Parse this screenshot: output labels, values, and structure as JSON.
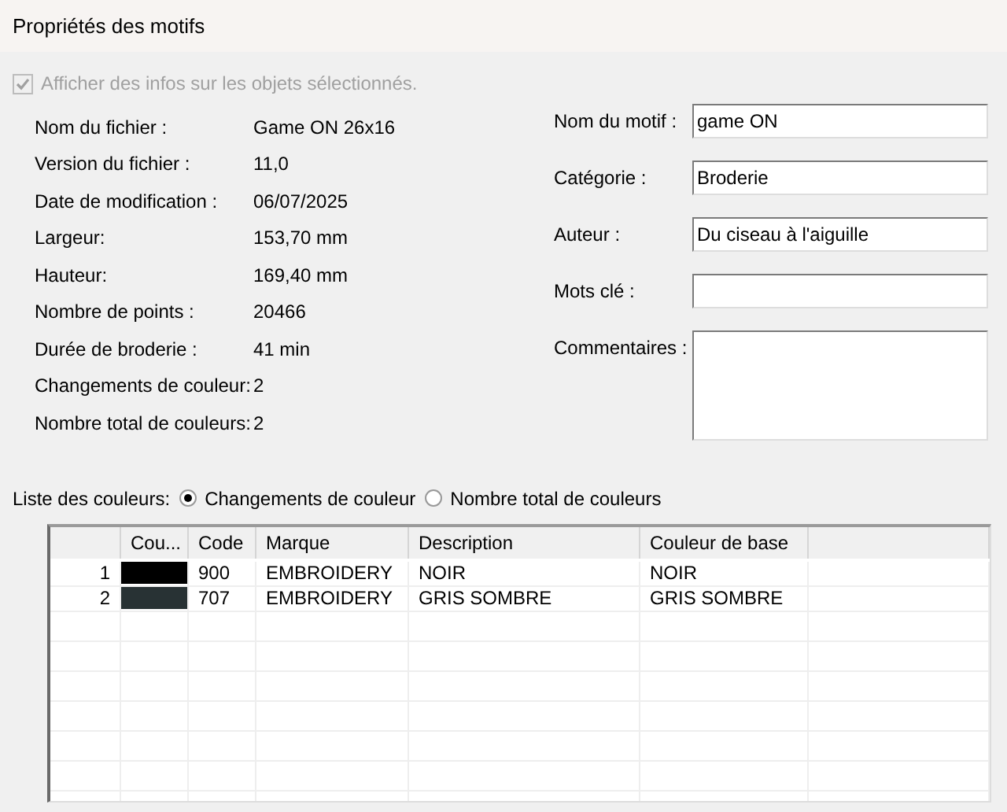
{
  "window": {
    "title": "Propriétés des motifs"
  },
  "show_info": {
    "label": "Afficher des infos sur les objets sélectionnés.",
    "checked": true,
    "disabled": true
  },
  "file_info": [
    {
      "label": "Nom du fichier :",
      "value": "Game ON 26x16"
    },
    {
      "label": "Version du fichier :",
      "value": "11,0"
    },
    {
      "label": "Date de modification :",
      "value": "06/07/2025"
    },
    {
      "label": "Largeur:",
      "value": "153,70 mm"
    },
    {
      "label": "Hauteur:",
      "value": "169,40 mm"
    },
    {
      "label": "Nombre de points :",
      "value": "20466"
    },
    {
      "label": "Durée de broderie :",
      "value": "41 min"
    },
    {
      "label": "Changements de couleur:",
      "value": "2"
    },
    {
      "label": "Nombre total de couleurs:",
      "value": "2"
    }
  ],
  "fields": [
    {
      "label": "Nom du motif :",
      "value": "game ON",
      "kind": "line"
    },
    {
      "label": "Catégorie :",
      "value": "Broderie",
      "kind": "line"
    },
    {
      "label": "Auteur :",
      "value": "Du ciseau à l'aiguille",
      "kind": "line"
    },
    {
      "label": "Mots clé :",
      "kind": "line"
    },
    {
      "label": "Commentaires :",
      "kind": "area"
    }
  ],
  "color_list": {
    "label": "Liste des couleurs:",
    "options": [
      {
        "label": "Changements de couleur",
        "selected": true
      },
      {
        "label": "Nombre total de couleurs",
        "selected": false
      }
    ]
  },
  "table": {
    "columns": [
      "Cou...",
      "Code",
      "Marque",
      "Description",
      "Couleur de base"
    ],
    "rows": [
      {
        "index": "1",
        "color": "#000000",
        "code": "900",
        "brand": "EMBROIDERY",
        "description": "NOIR",
        "base": "NOIR"
      },
      {
        "index": "2",
        "color": "#283234",
        "code": "707",
        "brand": "EMBROIDERY",
        "description": "GRIS SOMBRE",
        "base": "GRIS SOMBRE"
      }
    ]
  }
}
